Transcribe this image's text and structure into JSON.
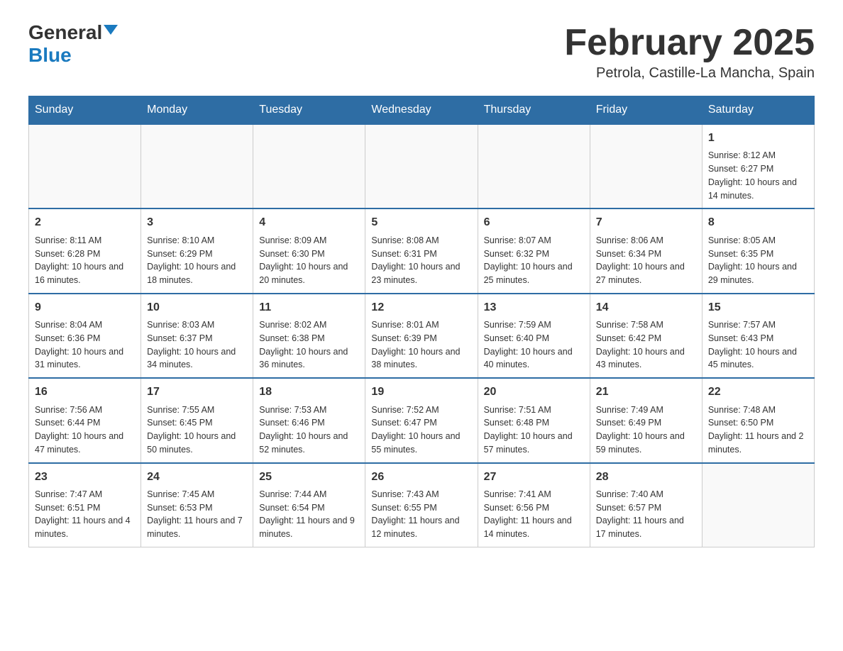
{
  "logo": {
    "text_general": "General",
    "text_blue": "Blue"
  },
  "title": "February 2025",
  "location": "Petrola, Castille-La Mancha, Spain",
  "days_of_week": [
    "Sunday",
    "Monday",
    "Tuesday",
    "Wednesday",
    "Thursday",
    "Friday",
    "Saturday"
  ],
  "weeks": [
    [
      {
        "day": "",
        "sunrise": "",
        "sunset": "",
        "daylight": ""
      },
      {
        "day": "",
        "sunrise": "",
        "sunset": "",
        "daylight": ""
      },
      {
        "day": "",
        "sunrise": "",
        "sunset": "",
        "daylight": ""
      },
      {
        "day": "",
        "sunrise": "",
        "sunset": "",
        "daylight": ""
      },
      {
        "day": "",
        "sunrise": "",
        "sunset": "",
        "daylight": ""
      },
      {
        "day": "",
        "sunrise": "",
        "sunset": "",
        "daylight": ""
      },
      {
        "day": "1",
        "sunrise": "Sunrise: 8:12 AM",
        "sunset": "Sunset: 6:27 PM",
        "daylight": "Daylight: 10 hours and 14 minutes."
      }
    ],
    [
      {
        "day": "2",
        "sunrise": "Sunrise: 8:11 AM",
        "sunset": "Sunset: 6:28 PM",
        "daylight": "Daylight: 10 hours and 16 minutes."
      },
      {
        "day": "3",
        "sunrise": "Sunrise: 8:10 AM",
        "sunset": "Sunset: 6:29 PM",
        "daylight": "Daylight: 10 hours and 18 minutes."
      },
      {
        "day": "4",
        "sunrise": "Sunrise: 8:09 AM",
        "sunset": "Sunset: 6:30 PM",
        "daylight": "Daylight: 10 hours and 20 minutes."
      },
      {
        "day": "5",
        "sunrise": "Sunrise: 8:08 AM",
        "sunset": "Sunset: 6:31 PM",
        "daylight": "Daylight: 10 hours and 23 minutes."
      },
      {
        "day": "6",
        "sunrise": "Sunrise: 8:07 AM",
        "sunset": "Sunset: 6:32 PM",
        "daylight": "Daylight: 10 hours and 25 minutes."
      },
      {
        "day": "7",
        "sunrise": "Sunrise: 8:06 AM",
        "sunset": "Sunset: 6:34 PM",
        "daylight": "Daylight: 10 hours and 27 minutes."
      },
      {
        "day": "8",
        "sunrise": "Sunrise: 8:05 AM",
        "sunset": "Sunset: 6:35 PM",
        "daylight": "Daylight: 10 hours and 29 minutes."
      }
    ],
    [
      {
        "day": "9",
        "sunrise": "Sunrise: 8:04 AM",
        "sunset": "Sunset: 6:36 PM",
        "daylight": "Daylight: 10 hours and 31 minutes."
      },
      {
        "day": "10",
        "sunrise": "Sunrise: 8:03 AM",
        "sunset": "Sunset: 6:37 PM",
        "daylight": "Daylight: 10 hours and 34 minutes."
      },
      {
        "day": "11",
        "sunrise": "Sunrise: 8:02 AM",
        "sunset": "Sunset: 6:38 PM",
        "daylight": "Daylight: 10 hours and 36 minutes."
      },
      {
        "day": "12",
        "sunrise": "Sunrise: 8:01 AM",
        "sunset": "Sunset: 6:39 PM",
        "daylight": "Daylight: 10 hours and 38 minutes."
      },
      {
        "day": "13",
        "sunrise": "Sunrise: 7:59 AM",
        "sunset": "Sunset: 6:40 PM",
        "daylight": "Daylight: 10 hours and 40 minutes."
      },
      {
        "day": "14",
        "sunrise": "Sunrise: 7:58 AM",
        "sunset": "Sunset: 6:42 PM",
        "daylight": "Daylight: 10 hours and 43 minutes."
      },
      {
        "day": "15",
        "sunrise": "Sunrise: 7:57 AM",
        "sunset": "Sunset: 6:43 PM",
        "daylight": "Daylight: 10 hours and 45 minutes."
      }
    ],
    [
      {
        "day": "16",
        "sunrise": "Sunrise: 7:56 AM",
        "sunset": "Sunset: 6:44 PM",
        "daylight": "Daylight: 10 hours and 47 minutes."
      },
      {
        "day": "17",
        "sunrise": "Sunrise: 7:55 AM",
        "sunset": "Sunset: 6:45 PM",
        "daylight": "Daylight: 10 hours and 50 minutes."
      },
      {
        "day": "18",
        "sunrise": "Sunrise: 7:53 AM",
        "sunset": "Sunset: 6:46 PM",
        "daylight": "Daylight: 10 hours and 52 minutes."
      },
      {
        "day": "19",
        "sunrise": "Sunrise: 7:52 AM",
        "sunset": "Sunset: 6:47 PM",
        "daylight": "Daylight: 10 hours and 55 minutes."
      },
      {
        "day": "20",
        "sunrise": "Sunrise: 7:51 AM",
        "sunset": "Sunset: 6:48 PM",
        "daylight": "Daylight: 10 hours and 57 minutes."
      },
      {
        "day": "21",
        "sunrise": "Sunrise: 7:49 AM",
        "sunset": "Sunset: 6:49 PM",
        "daylight": "Daylight: 10 hours and 59 minutes."
      },
      {
        "day": "22",
        "sunrise": "Sunrise: 7:48 AM",
        "sunset": "Sunset: 6:50 PM",
        "daylight": "Daylight: 11 hours and 2 minutes."
      }
    ],
    [
      {
        "day": "23",
        "sunrise": "Sunrise: 7:47 AM",
        "sunset": "Sunset: 6:51 PM",
        "daylight": "Daylight: 11 hours and 4 minutes."
      },
      {
        "day": "24",
        "sunrise": "Sunrise: 7:45 AM",
        "sunset": "Sunset: 6:53 PM",
        "daylight": "Daylight: 11 hours and 7 minutes."
      },
      {
        "day": "25",
        "sunrise": "Sunrise: 7:44 AM",
        "sunset": "Sunset: 6:54 PM",
        "daylight": "Daylight: 11 hours and 9 minutes."
      },
      {
        "day": "26",
        "sunrise": "Sunrise: 7:43 AM",
        "sunset": "Sunset: 6:55 PM",
        "daylight": "Daylight: 11 hours and 12 minutes."
      },
      {
        "day": "27",
        "sunrise": "Sunrise: 7:41 AM",
        "sunset": "Sunset: 6:56 PM",
        "daylight": "Daylight: 11 hours and 14 minutes."
      },
      {
        "day": "28",
        "sunrise": "Sunrise: 7:40 AM",
        "sunset": "Sunset: 6:57 PM",
        "daylight": "Daylight: 11 hours and 17 minutes."
      },
      {
        "day": "",
        "sunrise": "",
        "sunset": "",
        "daylight": ""
      }
    ]
  ]
}
